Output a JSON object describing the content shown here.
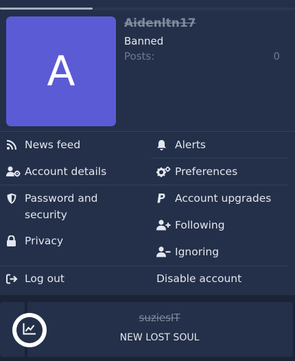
{
  "profile": {
    "avatar_letter": "A",
    "username": "Aidenltn17",
    "role": "Banned",
    "posts_label": "Posts:",
    "posts_count": "0"
  },
  "menu": {
    "news_feed": "News feed",
    "alerts": "Alerts",
    "account_details": "Account details",
    "preferences": "Preferences",
    "password_security": "Password and security",
    "account_upgrades": "Account upgrades",
    "following": "Following",
    "privacy": "Privacy",
    "ignoring": "Ignoring",
    "log_out": "Log out",
    "disable_account": "Disable account"
  },
  "footer": {
    "username": "suziesIT",
    "title": "NEW LOST SOUL",
    "badge_icon": "chart-line-icon"
  },
  "colors": {
    "background": "#1b2336",
    "panel": "#243049",
    "avatar": "#5c5bd6",
    "text": "#e3e7ef",
    "muted": "#7e899e"
  }
}
